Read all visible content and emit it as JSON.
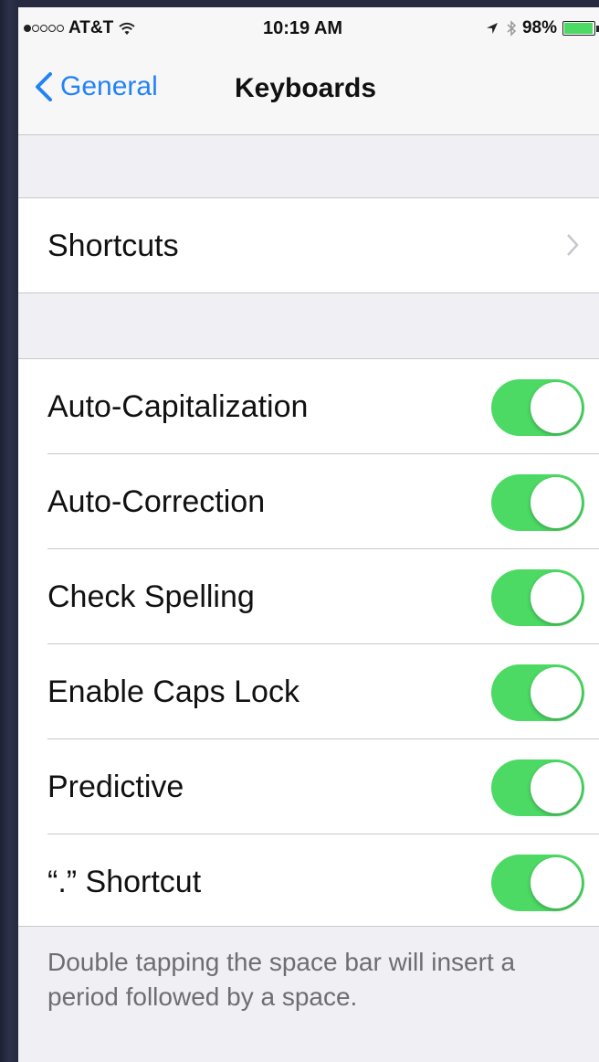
{
  "status_bar": {
    "signal_filled": 1,
    "signal_total": 5,
    "carrier": "AT&T",
    "time": "10:19 AM",
    "battery_percent": "98%",
    "battery_level": 0.98,
    "icons": [
      "wifi-icon",
      "location-icon",
      "bluetooth-icon",
      "battery-icon"
    ]
  },
  "nav": {
    "back_label": "General",
    "title": "Keyboards"
  },
  "shortcuts_row": {
    "label": "Shortcuts"
  },
  "toggles": [
    {
      "label": "Auto-Capitalization",
      "on": true
    },
    {
      "label": "Auto-Correction",
      "on": true
    },
    {
      "label": "Check Spelling",
      "on": true
    },
    {
      "label": "Enable Caps Lock",
      "on": true
    },
    {
      "label": "Predictive",
      "on": true
    },
    {
      "label": "“.” Shortcut",
      "on": true
    }
  ],
  "footer": {
    "note": "Double tapping the space bar will insert a period followed by a space."
  },
  "colors": {
    "accent": "#2283f6",
    "toggle_on": "#4cd964",
    "group_background": "#efeff4"
  }
}
